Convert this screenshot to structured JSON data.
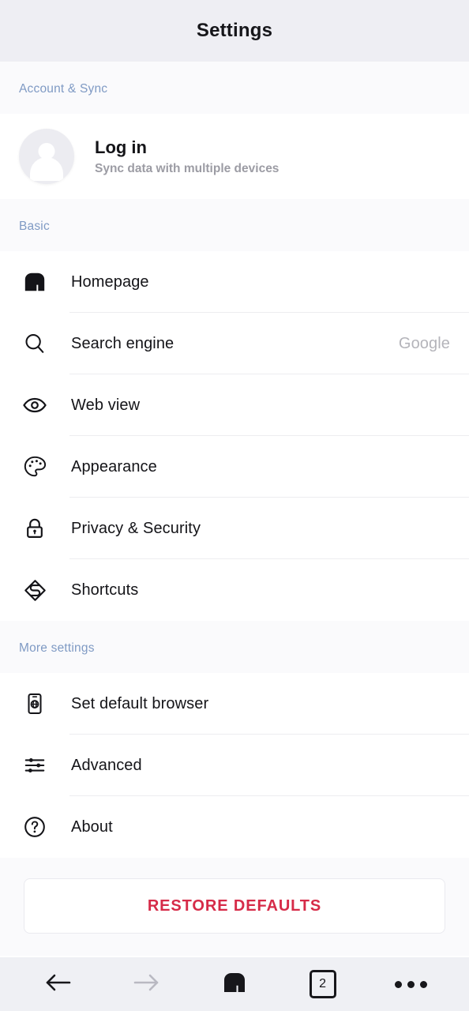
{
  "header": {
    "title": "Settings"
  },
  "account_section": {
    "label": "Account & Sync",
    "avatar_icon": "person-avatar-icon",
    "title": "Log in",
    "subtitle": "Sync data with multiple devices"
  },
  "basic_section": {
    "label": "Basic",
    "items": [
      {
        "icon": "maxthon-logo-icon",
        "label": "Homepage",
        "value": ""
      },
      {
        "icon": "search-icon",
        "label": "Search engine",
        "value": "Google"
      },
      {
        "icon": "eye-icon",
        "label": "Web view",
        "value": ""
      },
      {
        "icon": "palette-icon",
        "label": "Appearance",
        "value": ""
      },
      {
        "icon": "lock-icon",
        "label": "Privacy & Security",
        "value": ""
      },
      {
        "icon": "layers-icon",
        "label": "Shortcuts",
        "value": ""
      }
    ]
  },
  "more_section": {
    "label": "More settings",
    "items": [
      {
        "icon": "phone-globe-icon",
        "label": "Set default browser",
        "value": ""
      },
      {
        "icon": "sliders-icon",
        "label": "Advanced",
        "value": ""
      },
      {
        "icon": "question-circle-icon",
        "label": "About",
        "value": ""
      }
    ]
  },
  "restore": {
    "label": "RESTORE DEFAULTS"
  },
  "bottom_nav": {
    "back_icon": "arrow-left-icon",
    "forward_icon": "arrow-right-icon",
    "home_icon": "maxthon-logo-icon",
    "tab_count": "2",
    "menu_icon": "more-horizontal-icon"
  },
  "colors": {
    "header_bg": "#eeeef3",
    "section_label": "#7f9ac4",
    "restore_text": "#d62b48",
    "value_text": "#b4b4ba",
    "bottom_nav_bg": "#eff0f4",
    "forward_disabled": "#b9b9c2"
  }
}
